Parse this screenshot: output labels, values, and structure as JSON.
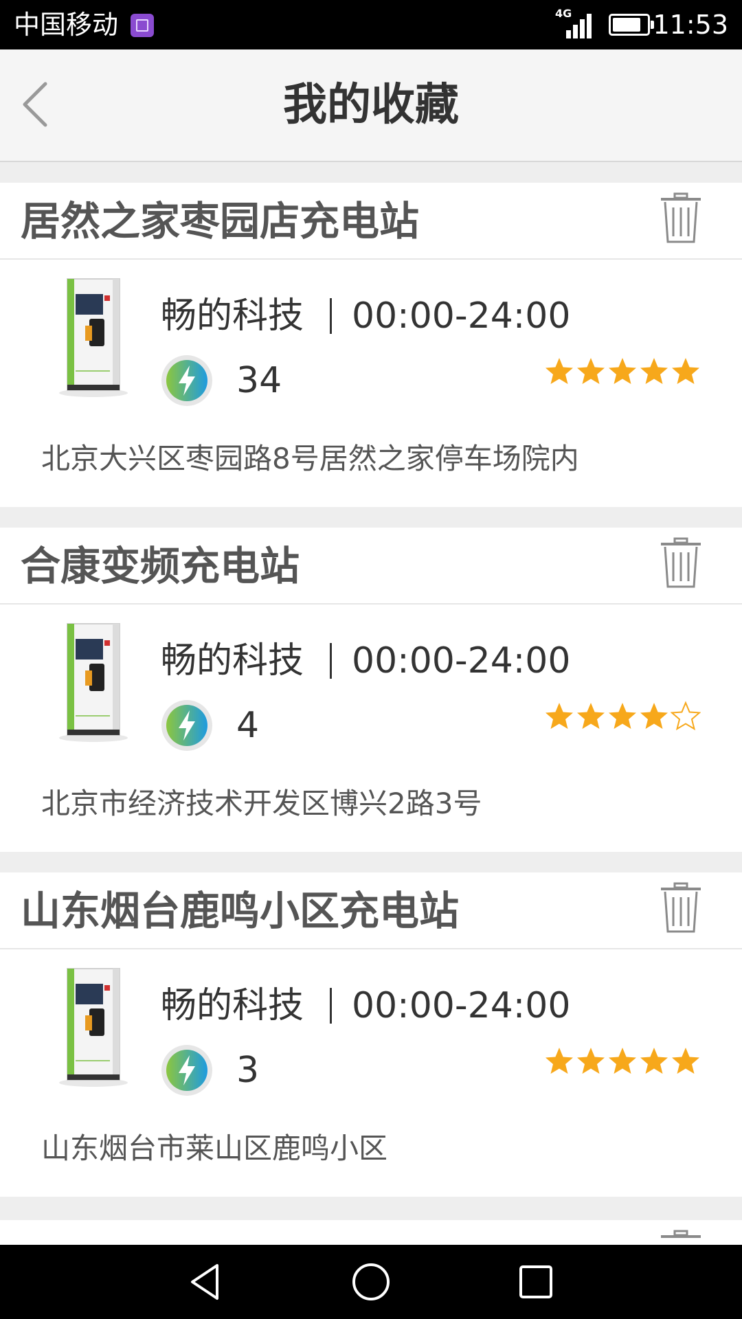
{
  "status_bar": {
    "carrier": "中国移动",
    "network": "4G",
    "time": "11:53"
  },
  "header": {
    "title": "我的收藏"
  },
  "colors": {
    "star": "#f7a81b",
    "star_empty": "#f7a81b",
    "brand_green": "#7ac143"
  },
  "favorites": [
    {
      "name": "居然之家枣园店充电站",
      "operator": "畅的科技",
      "hours": "00:00-24:00",
      "count": "34",
      "rating": 5,
      "address": "北京大兴区枣园路8号居然之家停车场院内"
    },
    {
      "name": "合康变频充电站",
      "operator": "畅的科技",
      "hours": "00:00-24:00",
      "count": "4",
      "rating": 4,
      "address": "北京市经济技术开发区博兴2路3号"
    },
    {
      "name": "山东烟台鹿鸣小区充电站",
      "operator": "畅的科技",
      "hours": "00:00-24:00",
      "count": "3",
      "rating": 5,
      "address": "山东烟台市莱山区鹿鸣小区"
    }
  ]
}
